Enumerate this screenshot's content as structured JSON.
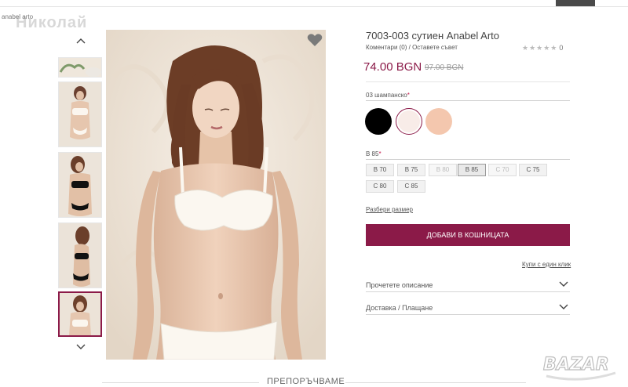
{
  "nav": {
    "active_label": ""
  },
  "breadcrumb": "anabel arto",
  "watermark": "Николай",
  "product": {
    "title": "7003-003 сутиен Anabel Arto",
    "reviews": "Коментари (0) / Оставете съвет",
    "stars": "★★★★★",
    "rating_count": "0",
    "price": "74.00 BGN",
    "old_price": "97.00 BGN"
  },
  "color": {
    "label": "03 шампанско",
    "required_mark": "*",
    "swatches": [
      {
        "name": "black",
        "hex": "#000000"
      },
      {
        "name": "champagne",
        "hex": "#f8ece8"
      },
      {
        "name": "nude",
        "hex": "#f4c7ae"
      }
    ]
  },
  "size": {
    "label": "B 85",
    "required_mark": "*",
    "options": [
      {
        "label": "B 70",
        "state": "available"
      },
      {
        "label": "B 75",
        "state": "available"
      },
      {
        "label": "B 80",
        "state": "disabled"
      },
      {
        "label": "B 85",
        "state": "selected"
      },
      {
        "label": "C 70",
        "state": "disabled"
      },
      {
        "label": "C 75",
        "state": "available"
      },
      {
        "label": "C 80",
        "state": "available"
      },
      {
        "label": "C 85",
        "state": "available"
      }
    ]
  },
  "size_guide": "Разбери размер",
  "add_to_cart": "ДОБАВИ В КОШНИЦАТА",
  "one_click": "Купи с един клик",
  "accordion": [
    "Прочетете описание",
    "Доставка / Плащане"
  ],
  "recommend": "ПРЕПОРЪЧВАМЕ",
  "logo_text": "BAZAR",
  "colors": {
    "accent": "#8b1a48"
  }
}
